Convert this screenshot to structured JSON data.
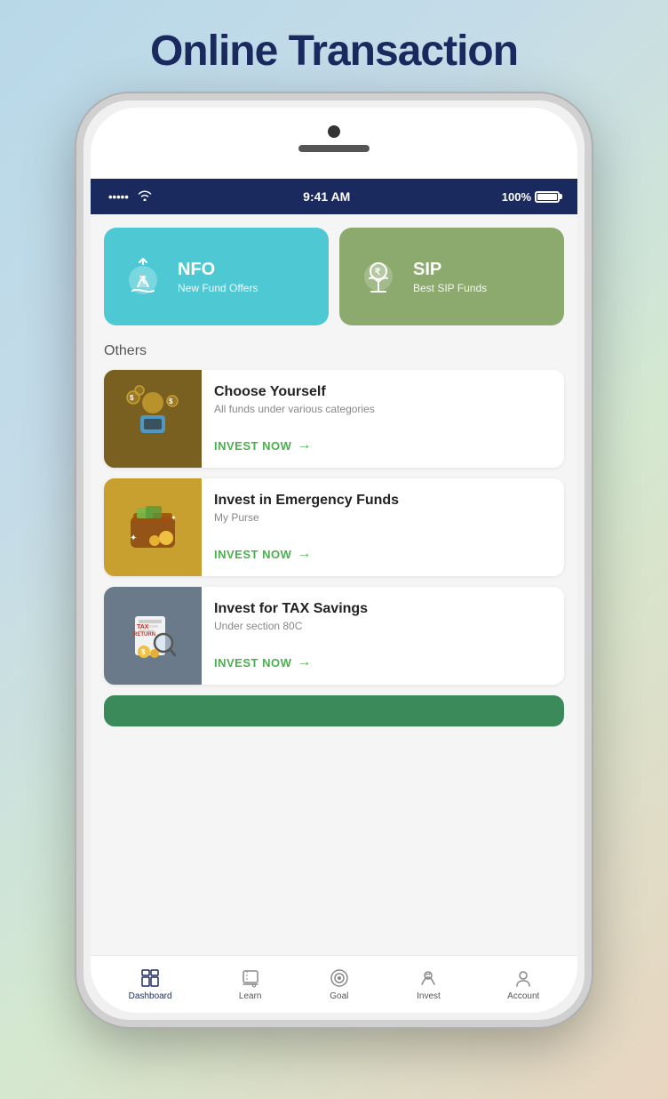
{
  "page": {
    "title": "Online Transaction"
  },
  "status_bar": {
    "dots": "•••••",
    "wifi": "wifi",
    "time": "9:41 AM",
    "battery_pct": "100%",
    "battery": "battery"
  },
  "cards": [
    {
      "id": "nfo",
      "title": "NFO",
      "subtitle": "New Fund Offers",
      "color": "#4ec9d4"
    },
    {
      "id": "sip",
      "title": "SIP",
      "subtitle": "Best SIP Funds",
      "color": "#8daa6e"
    }
  ],
  "section": {
    "others_label": "Others"
  },
  "list_items": [
    {
      "id": "choose-yourself",
      "title": "Choose Yourself",
      "subtitle": "All funds under various categories",
      "cta": "INVEST NOW"
    },
    {
      "id": "emergency-funds",
      "title": "Invest in Emergency Funds",
      "subtitle": "My Purse",
      "cta": "INVEST NOW"
    },
    {
      "id": "tax-savings",
      "title": "Invest for TAX Savings",
      "subtitle": "Under section 80C",
      "cta": "INVEST NOW"
    }
  ],
  "bottom_nav": [
    {
      "id": "dashboard",
      "label": "Dashboard",
      "active": true
    },
    {
      "id": "learn",
      "label": "Learn",
      "active": false
    },
    {
      "id": "goal",
      "label": "Goal",
      "active": false
    },
    {
      "id": "invest",
      "label": "Invest",
      "active": false
    },
    {
      "id": "account",
      "label": "Account",
      "active": false
    }
  ]
}
